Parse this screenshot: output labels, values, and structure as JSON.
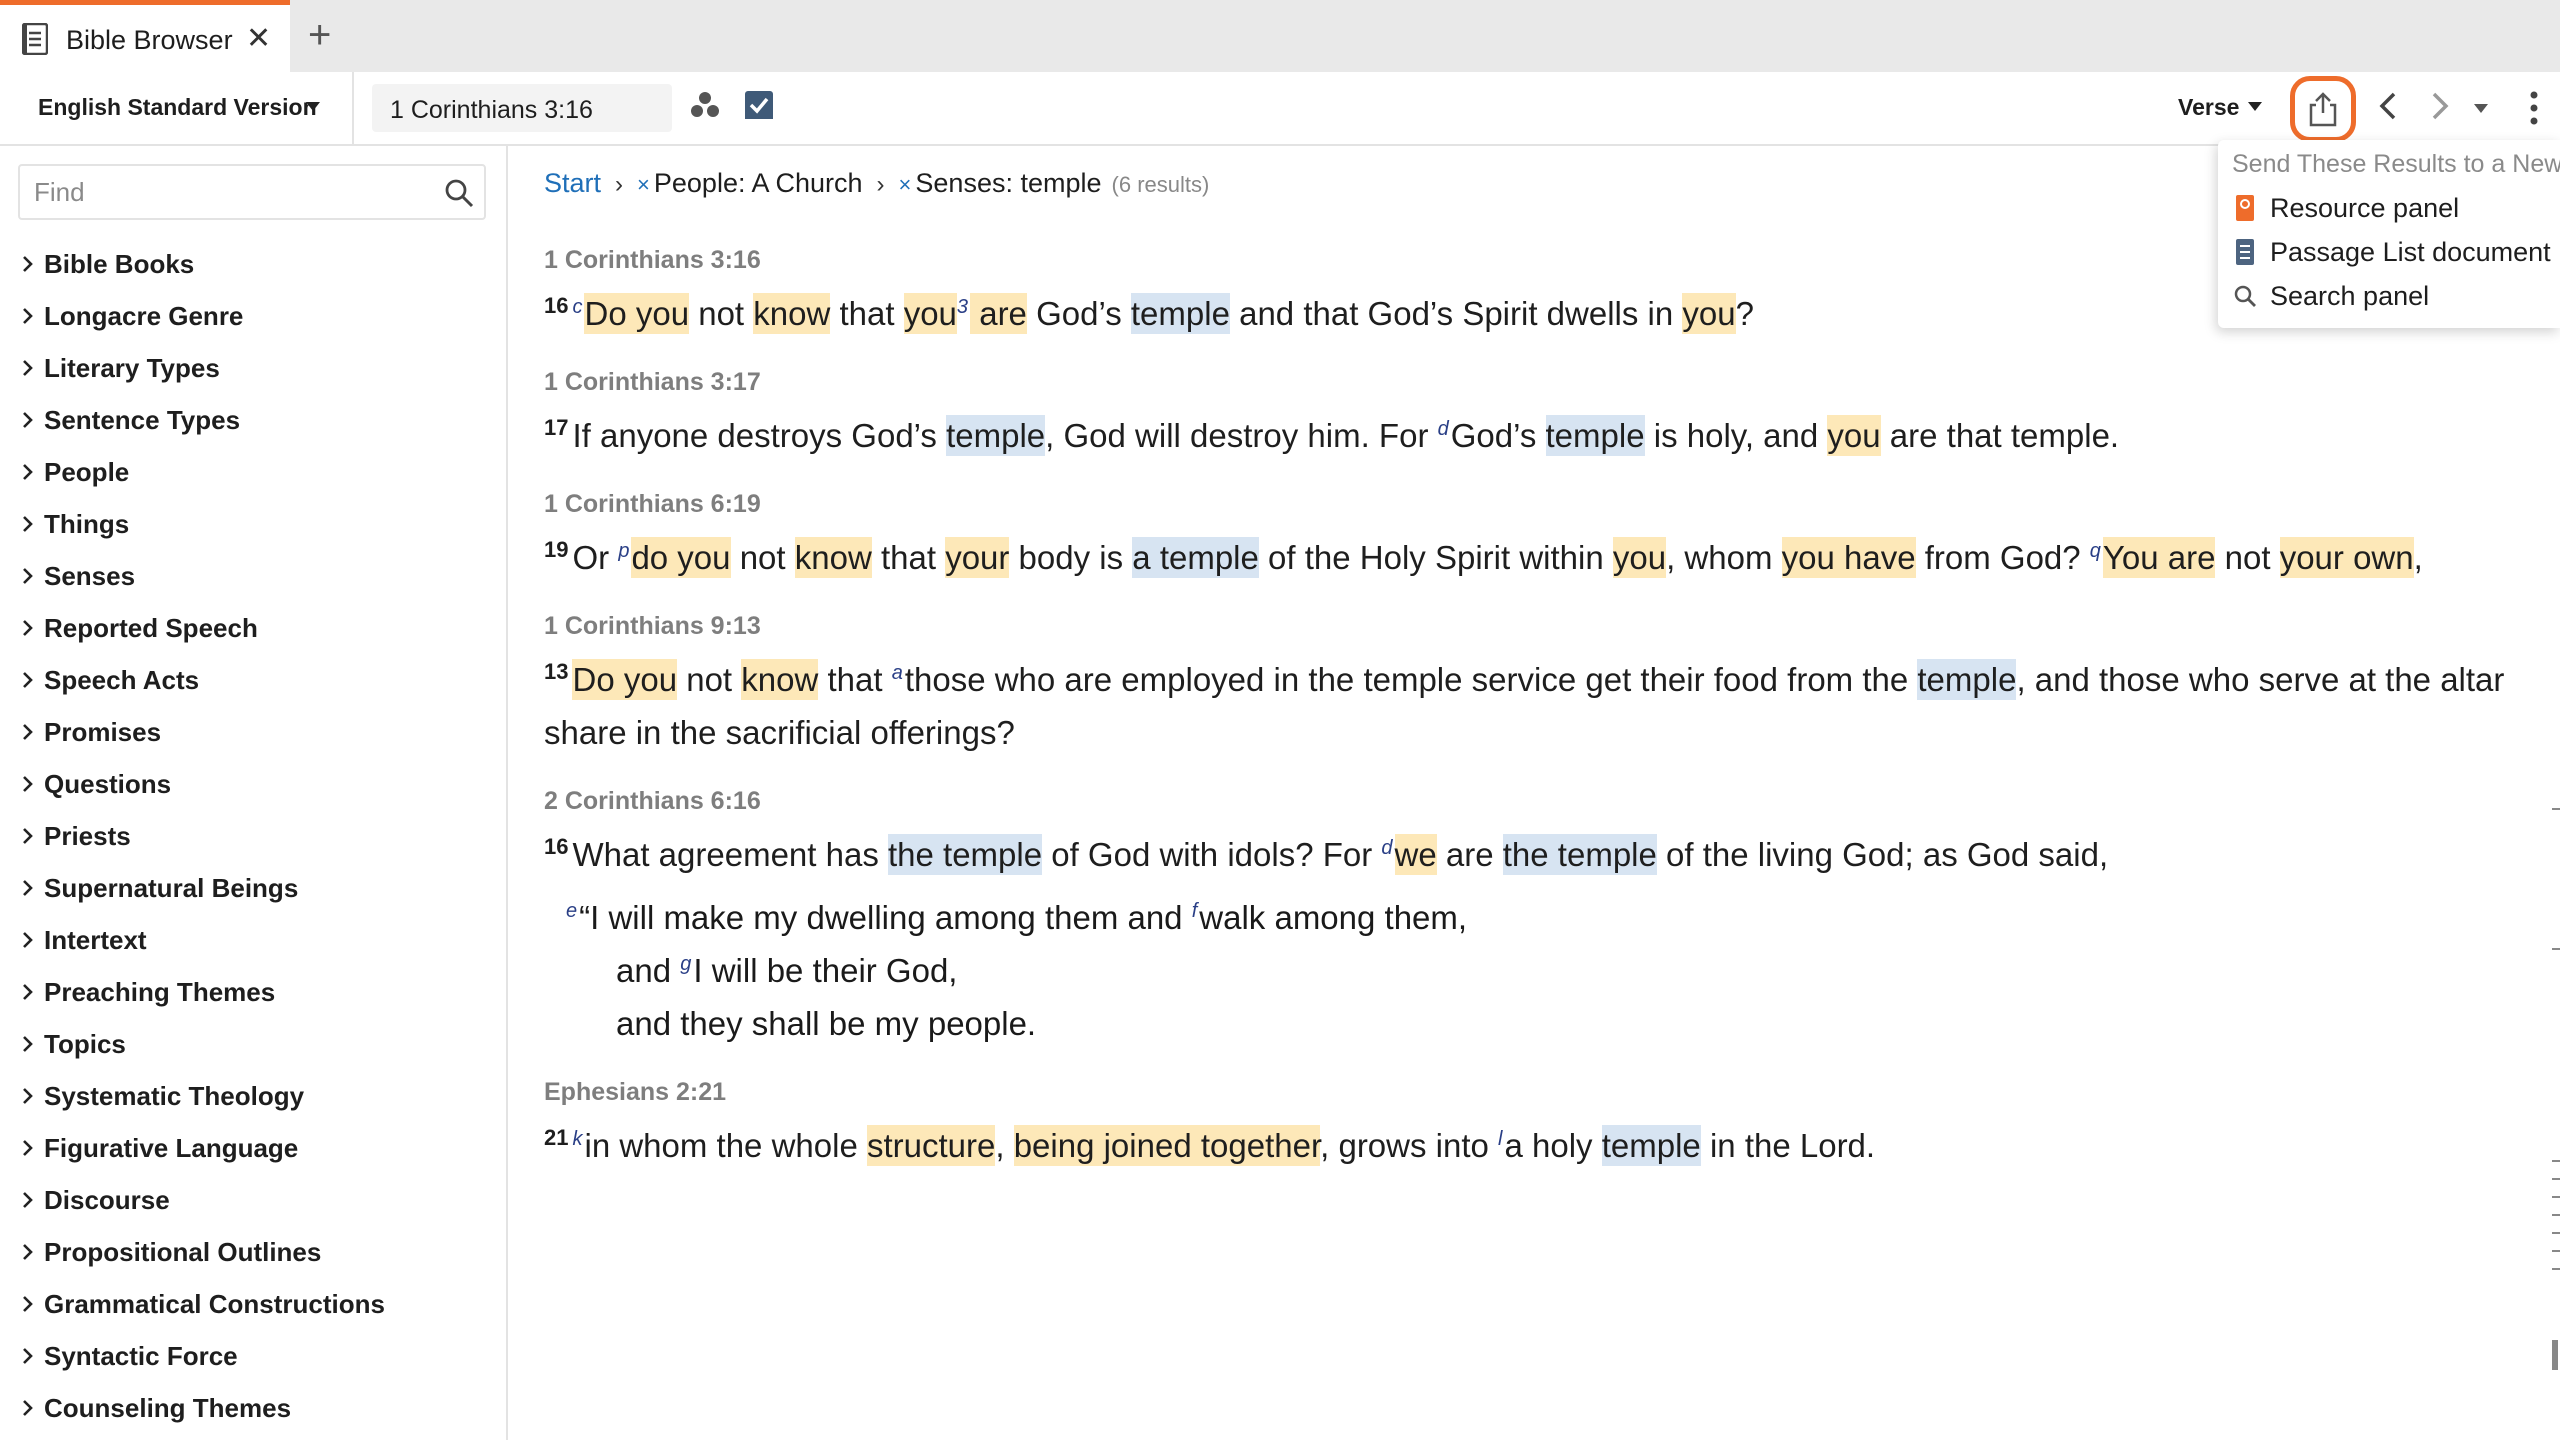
{
  "tab": {
    "title": "Bible Browser",
    "close": "✕",
    "add": "+"
  },
  "toolbar": {
    "version": "English Standard Version",
    "reference": "1 Corinthians 3:16",
    "view_mode": "Verse"
  },
  "sidebar": {
    "find_placeholder": "Find",
    "categories": [
      "Bible Books",
      "Longacre Genre",
      "Literary Types",
      "Sentence Types",
      "People",
      "Things",
      "Senses",
      "Reported Speech",
      "Speech Acts",
      "Promises",
      "Questions",
      "Priests",
      "Supernatural Beings",
      "Intertext",
      "Preaching Themes",
      "Topics",
      "Systematic Theology",
      "Figurative Language",
      "Discourse",
      "Propositional Outlines",
      "Grammatical Constructions",
      "Syntactic Force",
      "Counseling Themes"
    ]
  },
  "breadcrumb": {
    "start": "Start",
    "sep": "›",
    "x": "×",
    "people": "People: A Church",
    "senses": "Senses: temple",
    "count": "(6 results)"
  },
  "results": [
    {
      "ref": "1 Corinthians 3:16",
      "segments": [
        {
          "vn": "16"
        },
        {
          "fn": "c"
        },
        {
          "h": "y",
          "t": "Do you"
        },
        {
          "t": " not "
        },
        {
          "h": "y",
          "t": "know"
        },
        {
          "t": " that "
        },
        {
          "h": "y",
          "t": "you"
        },
        {
          "fn": "3"
        },
        {
          "h": "y",
          "t": " are"
        },
        {
          "t": " God’s "
        },
        {
          "h": "b",
          "t": "temple"
        },
        {
          "t": " and that God’s Spirit dwells in "
        },
        {
          "h": "y",
          "t": "you"
        },
        {
          "t": "?"
        }
      ]
    },
    {
      "ref": "1 Corinthians 3:17",
      "segments": [
        {
          "vn": "17"
        },
        {
          "t": "If anyone destroys God’s "
        },
        {
          "h": "b",
          "t": "temple"
        },
        {
          "t": ", God will destroy him. For "
        },
        {
          "fn": "d"
        },
        {
          "t": "God’s "
        },
        {
          "h": "b",
          "t": "temple"
        },
        {
          "t": " is holy, and "
        },
        {
          "h": "y",
          "t": "you"
        },
        {
          "t": " are that temple."
        }
      ]
    },
    {
      "ref": "1 Corinthians 6:19",
      "segments": [
        {
          "vn": "19"
        },
        {
          "t": "Or "
        },
        {
          "fn": "p"
        },
        {
          "h": "y",
          "t": "do you"
        },
        {
          "t": " not "
        },
        {
          "h": "y",
          "t": "know"
        },
        {
          "t": " that "
        },
        {
          "h": "y",
          "t": "your"
        },
        {
          "t": " body is "
        },
        {
          "h": "b",
          "t": "a temple"
        },
        {
          "t": " of the Holy Spirit within "
        },
        {
          "h": "y",
          "t": "you"
        },
        {
          "t": ", whom "
        },
        {
          "h": "y",
          "t": "you have"
        },
        {
          "t": " from God? "
        },
        {
          "fn": "q"
        },
        {
          "h": "y",
          "t": "You are"
        },
        {
          "t": " not "
        },
        {
          "h": "y",
          "t": "your own"
        },
        {
          "t": ","
        }
      ]
    },
    {
      "ref": "1 Corinthians 9:13",
      "segments": [
        {
          "vn": "13"
        },
        {
          "h": "y",
          "t": "Do you"
        },
        {
          "t": " not "
        },
        {
          "h": "y",
          "t": "know"
        },
        {
          "t": " that "
        },
        {
          "fn": "a"
        },
        {
          "t": "those who are employed in the temple service get their food from the "
        },
        {
          "h": "b",
          "t": "temple"
        },
        {
          "t": ", and those who serve at the altar share in the sacrificial offerings?"
        }
      ]
    },
    {
      "ref": "2 Corinthians 6:16",
      "segments": [
        {
          "vn": "16"
        },
        {
          "t": "What agreement has "
        },
        {
          "h": "b",
          "t": "the temple"
        },
        {
          "t": " of God with idols? For "
        },
        {
          "fn": "d"
        },
        {
          "h": "y",
          "t": "we"
        },
        {
          "t": " are "
        },
        {
          "h": "b",
          "t": "the temple"
        },
        {
          "t": " of the living God; as God said,"
        }
      ],
      "poetry": [
        {
          "indent": false,
          "segments": [
            {
              "fn": "e"
            },
            {
              "t": "“I will make my dwelling among them and "
            },
            {
              "fn": "f"
            },
            {
              "t": "walk among them,"
            }
          ]
        },
        {
          "indent": true,
          "segments": [
            {
              "t": "and "
            },
            {
              "fn": "g"
            },
            {
              "t": "I will be their God,"
            }
          ]
        },
        {
          "indent": true,
          "segments": [
            {
              "t": "and they shall be my people."
            }
          ]
        }
      ]
    },
    {
      "ref": "Ephesians 2:21",
      "segments": [
        {
          "vn": "21"
        },
        {
          "fn": "k"
        },
        {
          "t": "in whom the whole "
        },
        {
          "h": "y",
          "t": "structure"
        },
        {
          "t": ", "
        },
        {
          "h": "y",
          "t": "being joined together"
        },
        {
          "t": ", grows into "
        },
        {
          "fn": "l"
        },
        {
          "t": "a holy "
        },
        {
          "h": "b",
          "t": "temple"
        },
        {
          "t": " in the Lord."
        }
      ]
    }
  ],
  "dropdown": {
    "header": "Send These Results to a New",
    "items": [
      "Resource panel",
      "Passage List document",
      "Search panel"
    ]
  },
  "colors": {
    "accent": "#ee6c2b",
    "highlight_yellow": "#fde8b8",
    "highlight_blue": "#d7e4f2",
    "link": "#1f6fb8"
  },
  "icons": {
    "tab": "document-icon",
    "share": "share-export-icon",
    "search": "search-icon",
    "back": "chevron-left-icon",
    "forward": "chevron-right-icon",
    "more": "kebab-icon"
  }
}
